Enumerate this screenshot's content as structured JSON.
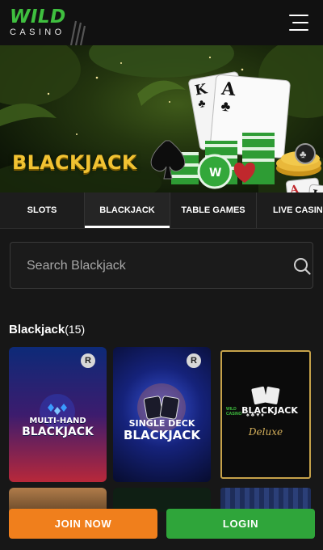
{
  "brand": {
    "wild": "WILD",
    "casino": "CASINO",
    "accent": "#3fbf3f"
  },
  "hero": {
    "title": "BLACKJACK"
  },
  "tabs": [
    {
      "label": "SLOTS",
      "active": false
    },
    {
      "label": "BLACKJACK",
      "active": true
    },
    {
      "label": "TABLE GAMES",
      "active": false
    },
    {
      "label": "LIVE CASINO",
      "active": false
    }
  ],
  "search": {
    "placeholder": "Search Blackjack",
    "value": ""
  },
  "section": {
    "title": "Blackjack",
    "count": "(15)"
  },
  "games": [
    {
      "title_line1": "MULTI-HAND",
      "title_line2": "BLACKJACK",
      "badge": "R"
    },
    {
      "title_line1": "SINGLE DECK",
      "title_line2": "BLACKJACK",
      "badge": "R"
    },
    {
      "title_line1": "BLACKJACK",
      "subtitle": "Deluxe",
      "brand_small": "WILD CASINO"
    }
  ],
  "buttons": {
    "join": "JOIN NOW",
    "login": "LOGIN",
    "join_color": "#f07f1c",
    "login_color": "#2fa53a"
  }
}
